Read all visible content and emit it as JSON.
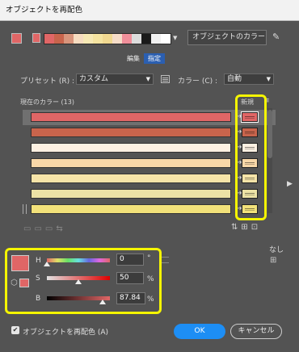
{
  "window": {
    "title": "オブジェクトを再配色"
  },
  "colors": {
    "current_color": "#e06666",
    "accent": "#1d8ef5",
    "highlight": "#f5f500"
  },
  "top": {
    "group_strip": [
      "#e06666",
      "#c8644c",
      "#d8957c",
      "#f6dcc0",
      "#f6e8b4",
      "#f4e3a0",
      "#f0d890",
      "#f5dcc8",
      "#f08f9a",
      "#dcdcdc",
      "#1a1a1a",
      "#f0f0f0",
      "#ffffff"
    ],
    "group_name": "オブジェクトのカラー",
    "dropdown_icon": "chevron-down-icon",
    "eyedropper_icon": "eyedropper-icon"
  },
  "tabs": [
    {
      "label": "編集",
      "active": false
    },
    {
      "label": "指定",
      "active": true
    }
  ],
  "preset": {
    "label": "プリセット (R) :",
    "value": "カスタム"
  },
  "color_mode": {
    "label": "カラー (C) :",
    "value": "自動"
  },
  "current_colors": {
    "label": "現在のカラー (13)",
    "new_label": "新規"
  },
  "rows": [
    {
      "current": "#e06666",
      "new": "#e06666",
      "selected": true
    },
    {
      "current": "#c8644c",
      "new": "#c8644c",
      "selected": false
    },
    {
      "current": "#fdf0e2",
      "new": "#fdf0e2",
      "selected": false
    },
    {
      "current": "#f8d7a8",
      "new": "#f8d7a8",
      "selected": false
    },
    {
      "current": "#f6e4a8",
      "new": "#f6e4a8",
      "selected": false
    },
    {
      "current": "#ece2a6",
      "new": "#ece2a6",
      "selected": false
    },
    {
      "current": "#f2e17a",
      "new": "#f2e17a",
      "selected": false
    }
  ],
  "hsb": {
    "h": {
      "label": "H",
      "value": "0",
      "unit": "°",
      "level": 0.0
    },
    "s": {
      "label": "S",
      "value": "50",
      "unit": "%",
      "level": 0.5
    },
    "b": {
      "label": "B",
      "value": "87.84",
      "unit": "%",
      "level": 0.8784
    }
  },
  "none_label": "なし",
  "footer": {
    "recolor_label": "オブジェクトを再配色 (A)",
    "recolor_checked": true,
    "ok_label": "OK",
    "cancel_label": "キャンセル"
  }
}
